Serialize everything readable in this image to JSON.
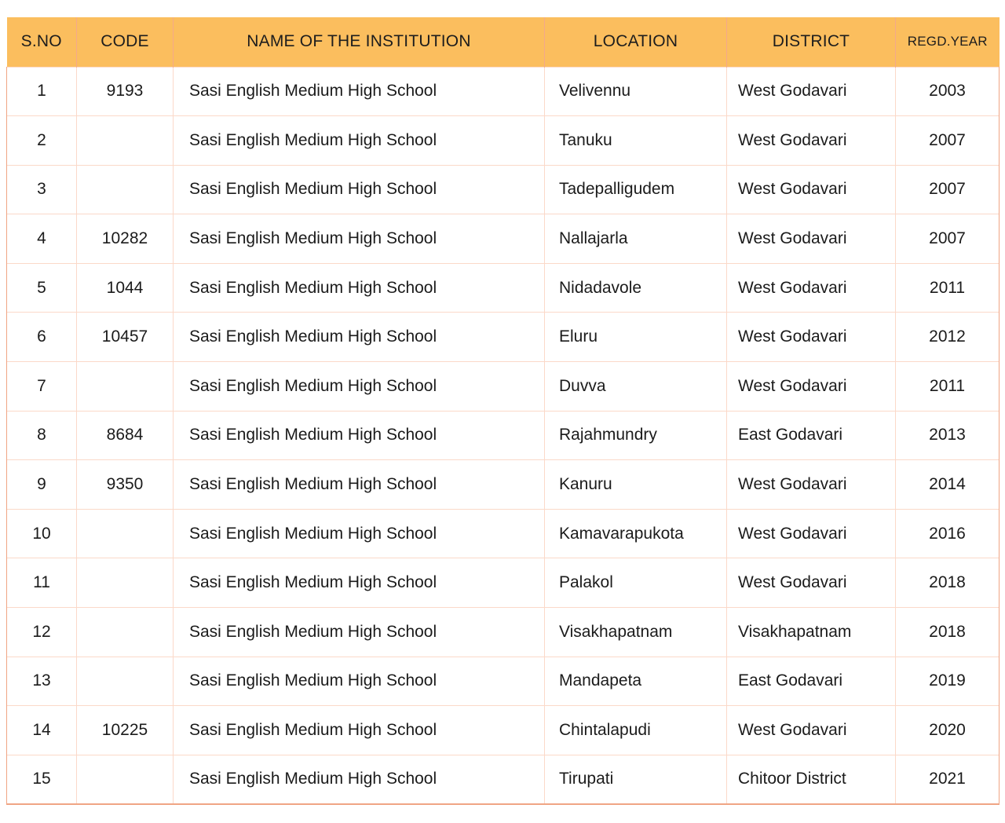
{
  "table": {
    "headers": [
      {
        "key": "sno",
        "label": "S.NO"
      },
      {
        "key": "code",
        "label": "CODE"
      },
      {
        "key": "name",
        "label": "NAME OF THE INSTITUTION"
      },
      {
        "key": "loc",
        "label": "LOCATION"
      },
      {
        "key": "dist",
        "label": "DISTRICT"
      },
      {
        "key": "year",
        "label": "REGD.YEAR"
      }
    ],
    "header_bg": "#fbbe5e",
    "border_color": "#f0a584",
    "row_line_color": "#fbd9c9",
    "rows": [
      {
        "sno": "1",
        "code": "9193",
        "name": "Sasi English Medium High School",
        "loc": "Velivennu",
        "dist": "West Godavari",
        "year": "2003"
      },
      {
        "sno": "2",
        "code": "",
        "name": "Sasi English Medium High School",
        "loc": "Tanuku",
        "dist": "West Godavari",
        "year": "2007"
      },
      {
        "sno": "3",
        "code": "",
        "name": "Sasi English Medium High School",
        "loc": "Tadepalligudem",
        "dist": "West Godavari",
        "year": "2007"
      },
      {
        "sno": "4",
        "code": "10282",
        "name": "Sasi English Medium High School",
        "loc": "Nallajarla",
        "dist": "West Godavari",
        "year": "2007"
      },
      {
        "sno": "5",
        "code": "1044",
        "name": "Sasi English Medium High School",
        "loc": "Nidadavole",
        "dist": "West Godavari",
        "year": "2011"
      },
      {
        "sno": "6",
        "code": "10457",
        "name": "Sasi English Medium High School",
        "loc": "Eluru",
        "dist": "West Godavari",
        "year": "2012"
      },
      {
        "sno": "7",
        "code": "",
        "name": "Sasi English Medium High School",
        "loc": "Duvva",
        "dist": "West Godavari",
        "year": "2011"
      },
      {
        "sno": "8",
        "code": "8684",
        "name": "Sasi English Medium High School",
        "loc": "Rajahmundry",
        "dist": "East Godavari",
        "year": "2013"
      },
      {
        "sno": "9",
        "code": "9350",
        "name": "Sasi English Medium High School",
        "loc": "Kanuru",
        "dist": "West Godavari",
        "year": "2014"
      },
      {
        "sno": "10",
        "code": "",
        "name": "Sasi English Medium High School",
        "loc": "Kamavarapukota",
        "dist": "West Godavari",
        "year": "2016"
      },
      {
        "sno": "11",
        "code": "",
        "name": "Sasi English Medium High School",
        "loc": "Palakol",
        "dist": "West Godavari",
        "year": "2018"
      },
      {
        "sno": "12",
        "code": "",
        "name": "Sasi English Medium High School",
        "loc": "Visakhapatnam",
        "dist": "Visakhapatnam",
        "year": "2018"
      },
      {
        "sno": "13",
        "code": "",
        "name": "Sasi English Medium High School",
        "loc": "Mandapeta",
        "dist": "East Godavari",
        "year": "2019"
      },
      {
        "sno": "14",
        "code": "10225",
        "name": "Sasi English Medium High School",
        "loc": "Chintalapudi",
        "dist": "West Godavari",
        "year": "2020"
      },
      {
        "sno": "15",
        "code": "",
        "name": "Sasi English Medium High School",
        "loc": "Tirupati",
        "dist": "Chitoor District",
        "year": "2021"
      }
    ]
  }
}
